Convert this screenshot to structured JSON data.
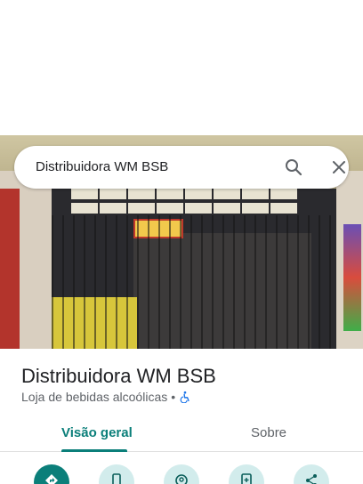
{
  "search": {
    "query": "Distribuidora WM BSB",
    "search_icon": "search-icon",
    "close_icon": "close-icon"
  },
  "photo": {
    "description_icon": "storefront-photo",
    "sign_text": "NO DINHEIRO"
  },
  "place": {
    "name": "Distribuidora WM BSB",
    "category": "Loja de bebidas alcoólicas",
    "separator": "•",
    "accessibility_icon": "wheelchair-icon"
  },
  "tabs": [
    {
      "label": "Visão geral",
      "active": true
    },
    {
      "label": "Sobre",
      "active": false
    }
  ],
  "actions": [
    {
      "icon": "directions-icon"
    },
    {
      "icon": "phone-icon"
    },
    {
      "icon": "nearby-icon"
    },
    {
      "icon": "save-icon"
    },
    {
      "icon": "share-icon"
    }
  ],
  "colors": {
    "accent": "#0b7f7a",
    "accent_light": "#d2ecec",
    "text_primary": "#202124",
    "text_secondary": "#5f6368"
  }
}
